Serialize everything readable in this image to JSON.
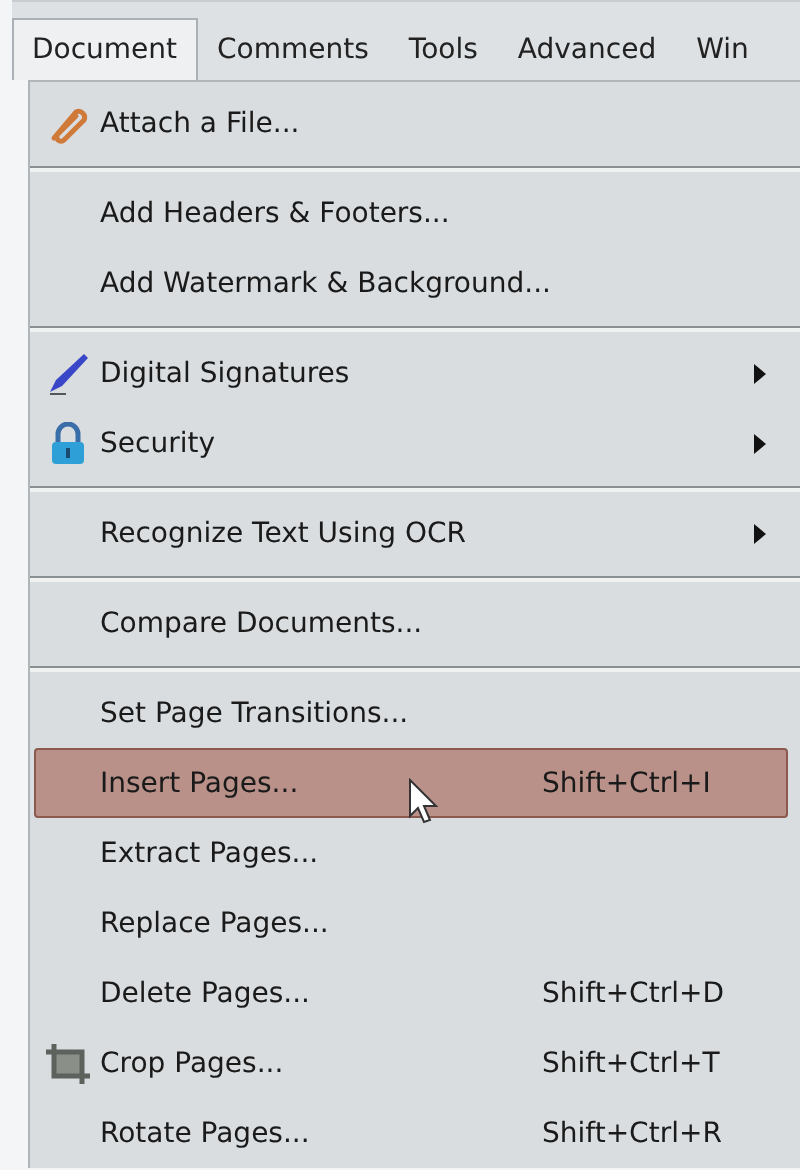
{
  "menu_bar": [
    {
      "label": "Document",
      "selected": true
    },
    {
      "label": "Comments",
      "selected": false
    },
    {
      "label": "Tools",
      "selected": false
    },
    {
      "label": "Advanced",
      "selected": false
    },
    {
      "label": "Win",
      "selected": false
    }
  ],
  "menu": {
    "groups": [
      [
        {
          "kind": "attach",
          "label": "Attach a File...",
          "selected": false
        }
      ],
      [
        {
          "kind": "plain",
          "label": "Add Headers & Footers...",
          "selected": false
        },
        {
          "kind": "plain",
          "label": "Add Watermark & Background...",
          "selected": false
        }
      ],
      [
        {
          "kind": "sign",
          "label": "Digital Signatures",
          "submenu": true,
          "selected": false
        },
        {
          "kind": "lock",
          "label": "Security",
          "submenu": true,
          "selected": false
        }
      ],
      [
        {
          "kind": "plain",
          "label": "Recognize Text Using OCR",
          "submenu": true,
          "selected": false
        }
      ],
      [
        {
          "kind": "plain",
          "label": "Compare Documents...",
          "selected": false
        }
      ],
      [
        {
          "kind": "plain",
          "label": "Set Page Transitions...",
          "selected": false
        },
        {
          "kind": "plain",
          "label": "Insert Pages...",
          "shortcut": "Shift+Ctrl+I",
          "selected": true
        },
        {
          "kind": "plain",
          "label": "Extract Pages...",
          "selected": false
        },
        {
          "kind": "plain",
          "label": "Replace Pages...",
          "selected": false
        },
        {
          "kind": "plain",
          "label": "Delete Pages...",
          "shortcut": "Shift+Ctrl+D",
          "selected": false
        },
        {
          "kind": "crop",
          "label": "Crop Pages...",
          "shortcut": "Shift+Ctrl+T",
          "selected": false
        },
        {
          "kind": "plain",
          "label": "Rotate Pages...",
          "shortcut": "Shift+Ctrl+R",
          "selected": false
        }
      ]
    ]
  }
}
